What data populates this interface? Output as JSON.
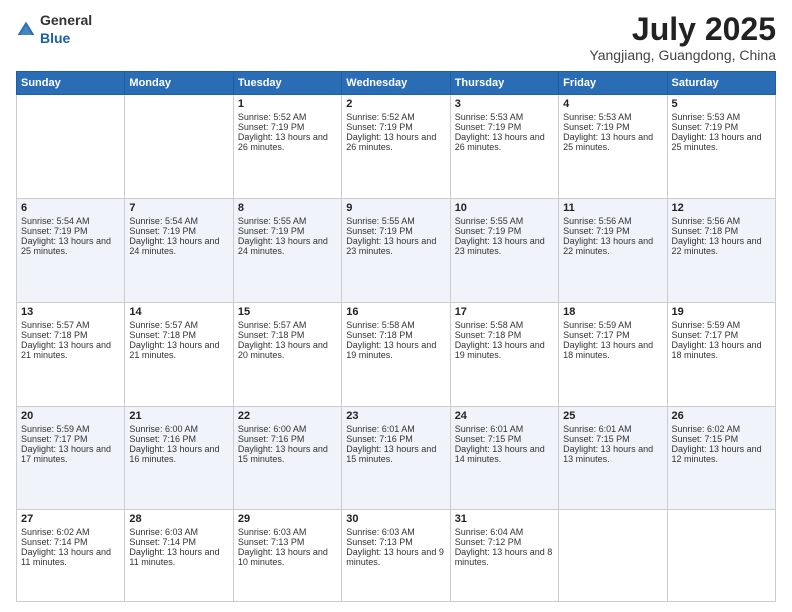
{
  "logo": {
    "general": "General",
    "blue": "Blue"
  },
  "header": {
    "month_year": "July 2025",
    "location": "Yangjiang, Guangdong, China"
  },
  "weekdays": [
    "Sunday",
    "Monday",
    "Tuesday",
    "Wednesday",
    "Thursday",
    "Friday",
    "Saturday"
  ],
  "weeks": [
    [
      {
        "day": "",
        "empty": true
      },
      {
        "day": "",
        "empty": true
      },
      {
        "day": "1",
        "sunrise": "Sunrise: 5:52 AM",
        "sunset": "Sunset: 7:19 PM",
        "daylight": "Daylight: 13 hours and 26 minutes."
      },
      {
        "day": "2",
        "sunrise": "Sunrise: 5:52 AM",
        "sunset": "Sunset: 7:19 PM",
        "daylight": "Daylight: 13 hours and 26 minutes."
      },
      {
        "day": "3",
        "sunrise": "Sunrise: 5:53 AM",
        "sunset": "Sunset: 7:19 PM",
        "daylight": "Daylight: 13 hours and 26 minutes."
      },
      {
        "day": "4",
        "sunrise": "Sunrise: 5:53 AM",
        "sunset": "Sunset: 7:19 PM",
        "daylight": "Daylight: 13 hours and 25 minutes."
      },
      {
        "day": "5",
        "sunrise": "Sunrise: 5:53 AM",
        "sunset": "Sunset: 7:19 PM",
        "daylight": "Daylight: 13 hours and 25 minutes."
      }
    ],
    [
      {
        "day": "6",
        "sunrise": "Sunrise: 5:54 AM",
        "sunset": "Sunset: 7:19 PM",
        "daylight": "Daylight: 13 hours and 25 minutes."
      },
      {
        "day": "7",
        "sunrise": "Sunrise: 5:54 AM",
        "sunset": "Sunset: 7:19 PM",
        "daylight": "Daylight: 13 hours and 24 minutes."
      },
      {
        "day": "8",
        "sunrise": "Sunrise: 5:55 AM",
        "sunset": "Sunset: 7:19 PM",
        "daylight": "Daylight: 13 hours and 24 minutes."
      },
      {
        "day": "9",
        "sunrise": "Sunrise: 5:55 AM",
        "sunset": "Sunset: 7:19 PM",
        "daylight": "Daylight: 13 hours and 23 minutes."
      },
      {
        "day": "10",
        "sunrise": "Sunrise: 5:55 AM",
        "sunset": "Sunset: 7:19 PM",
        "daylight": "Daylight: 13 hours and 23 minutes."
      },
      {
        "day": "11",
        "sunrise": "Sunrise: 5:56 AM",
        "sunset": "Sunset: 7:19 PM",
        "daylight": "Daylight: 13 hours and 22 minutes."
      },
      {
        "day": "12",
        "sunrise": "Sunrise: 5:56 AM",
        "sunset": "Sunset: 7:18 PM",
        "daylight": "Daylight: 13 hours and 22 minutes."
      }
    ],
    [
      {
        "day": "13",
        "sunrise": "Sunrise: 5:57 AM",
        "sunset": "Sunset: 7:18 PM",
        "daylight": "Daylight: 13 hours and 21 minutes."
      },
      {
        "day": "14",
        "sunrise": "Sunrise: 5:57 AM",
        "sunset": "Sunset: 7:18 PM",
        "daylight": "Daylight: 13 hours and 21 minutes."
      },
      {
        "day": "15",
        "sunrise": "Sunrise: 5:57 AM",
        "sunset": "Sunset: 7:18 PM",
        "daylight": "Daylight: 13 hours and 20 minutes."
      },
      {
        "day": "16",
        "sunrise": "Sunrise: 5:58 AM",
        "sunset": "Sunset: 7:18 PM",
        "daylight": "Daylight: 13 hours and 19 minutes."
      },
      {
        "day": "17",
        "sunrise": "Sunrise: 5:58 AM",
        "sunset": "Sunset: 7:18 PM",
        "daylight": "Daylight: 13 hours and 19 minutes."
      },
      {
        "day": "18",
        "sunrise": "Sunrise: 5:59 AM",
        "sunset": "Sunset: 7:17 PM",
        "daylight": "Daylight: 13 hours and 18 minutes."
      },
      {
        "day": "19",
        "sunrise": "Sunrise: 5:59 AM",
        "sunset": "Sunset: 7:17 PM",
        "daylight": "Daylight: 13 hours and 18 minutes."
      }
    ],
    [
      {
        "day": "20",
        "sunrise": "Sunrise: 5:59 AM",
        "sunset": "Sunset: 7:17 PM",
        "daylight": "Daylight: 13 hours and 17 minutes."
      },
      {
        "day": "21",
        "sunrise": "Sunrise: 6:00 AM",
        "sunset": "Sunset: 7:16 PM",
        "daylight": "Daylight: 13 hours and 16 minutes."
      },
      {
        "day": "22",
        "sunrise": "Sunrise: 6:00 AM",
        "sunset": "Sunset: 7:16 PM",
        "daylight": "Daylight: 13 hours and 15 minutes."
      },
      {
        "day": "23",
        "sunrise": "Sunrise: 6:01 AM",
        "sunset": "Sunset: 7:16 PM",
        "daylight": "Daylight: 13 hours and 15 minutes."
      },
      {
        "day": "24",
        "sunrise": "Sunrise: 6:01 AM",
        "sunset": "Sunset: 7:15 PM",
        "daylight": "Daylight: 13 hours and 14 minutes."
      },
      {
        "day": "25",
        "sunrise": "Sunrise: 6:01 AM",
        "sunset": "Sunset: 7:15 PM",
        "daylight": "Daylight: 13 hours and 13 minutes."
      },
      {
        "day": "26",
        "sunrise": "Sunrise: 6:02 AM",
        "sunset": "Sunset: 7:15 PM",
        "daylight": "Daylight: 13 hours and 12 minutes."
      }
    ],
    [
      {
        "day": "27",
        "sunrise": "Sunrise: 6:02 AM",
        "sunset": "Sunset: 7:14 PM",
        "daylight": "Daylight: 13 hours and 11 minutes."
      },
      {
        "day": "28",
        "sunrise": "Sunrise: 6:03 AM",
        "sunset": "Sunset: 7:14 PM",
        "daylight": "Daylight: 13 hours and 11 minutes."
      },
      {
        "day": "29",
        "sunrise": "Sunrise: 6:03 AM",
        "sunset": "Sunset: 7:13 PM",
        "daylight": "Daylight: 13 hours and 10 minutes."
      },
      {
        "day": "30",
        "sunrise": "Sunrise: 6:03 AM",
        "sunset": "Sunset: 7:13 PM",
        "daylight": "Daylight: 13 hours and 9 minutes."
      },
      {
        "day": "31",
        "sunrise": "Sunrise: 6:04 AM",
        "sunset": "Sunset: 7:12 PM",
        "daylight": "Daylight: 13 hours and 8 minutes."
      },
      {
        "day": "",
        "empty": true
      },
      {
        "day": "",
        "empty": true
      }
    ]
  ]
}
